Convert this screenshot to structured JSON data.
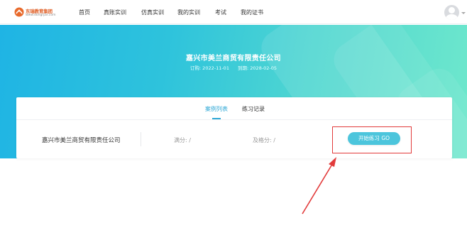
{
  "header": {
    "logo": {
      "title": "东瑞教育集团",
      "subtitle": "www.dongrjzx.com",
      "icon": "logo-mark-icon"
    },
    "nav": [
      {
        "label": "首页"
      },
      {
        "label": "真账实训"
      },
      {
        "label": "仿真实训"
      },
      {
        "label": "我的实训"
      },
      {
        "label": "考试"
      },
      {
        "label": "我的证书"
      }
    ],
    "avatar_icon": "user-avatar-icon"
  },
  "banner": {
    "title": "嘉兴市美兰商贸有限责任公司",
    "order_date": "订购: 2022-11-01",
    "expire_date": "到期: 2028-02-05"
  },
  "card": {
    "tabs": [
      {
        "label": "案例列表",
        "active": true
      },
      {
        "label": "练习记录",
        "active": false
      }
    ],
    "row": {
      "company": "嘉兴市美兰商贸有限责任公司",
      "full_score": "满分: /",
      "pass_score": "及格分: /",
      "start_button": "开始练习 GO"
    }
  },
  "colors": {
    "accent": "#2fa8d6",
    "button": "#4cc5dc",
    "annotation": "#e23b3b",
    "banner_start": "#1fb4e4",
    "banner_end": "#6fe8cc"
  }
}
